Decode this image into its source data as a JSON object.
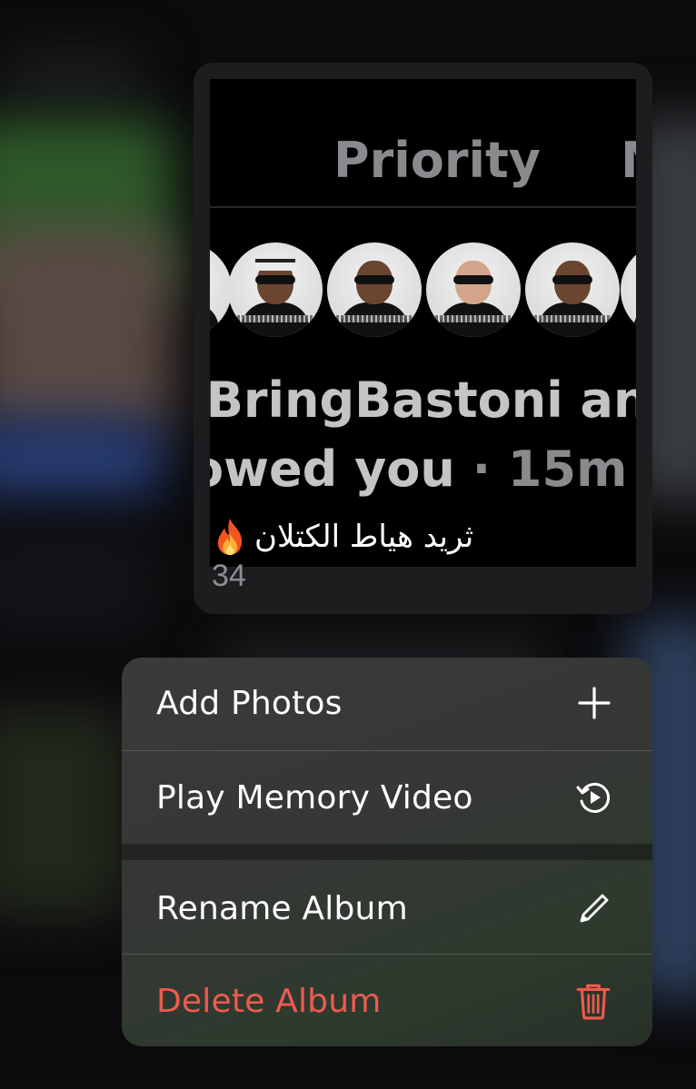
{
  "preview": {
    "thumbnail": {
      "tab_primary": "Priority",
      "tab_secondary": "M",
      "text_line1": "/BringBastoni and",
      "text_line2_main": "owed you",
      "text_line2_time": " · 15m"
    },
    "album_name": "ثريد هياط الكتلان",
    "album_emoji_icon": "fire-icon",
    "item_count": "34"
  },
  "menu": {
    "items": [
      {
        "label": "Add Photos",
        "icon": "plus-icon"
      },
      {
        "label": "Play Memory Video",
        "icon": "memory-play-icon"
      },
      {
        "label": "Rename Album",
        "icon": "pencil-icon"
      },
      {
        "label": "Delete Album",
        "icon": "trash-icon",
        "color": "#ee5b4e"
      }
    ]
  },
  "colors": {
    "destructive": "#ee5b4e",
    "menu_text": "#ffffff",
    "secondary_text": "#8e8e93"
  }
}
